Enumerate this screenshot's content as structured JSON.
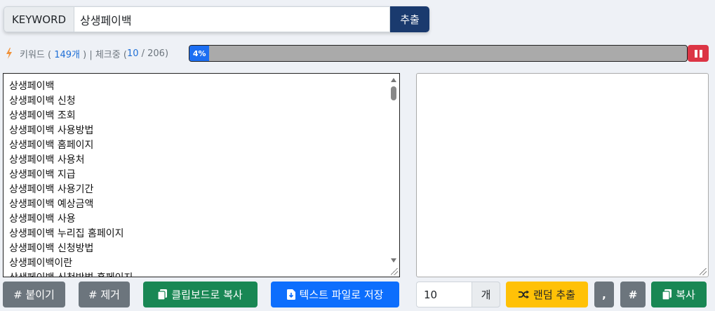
{
  "search": {
    "label": "KEYWORD",
    "value": "상생페이백",
    "button": "추출"
  },
  "status": {
    "keyword_label": "키워드 ( ",
    "keyword_count": "149개",
    "mid": " ) | 체크중 (",
    "checked": "10",
    "separator": " / ",
    "total": "206",
    "end": ")",
    "progress_label": "4%",
    "progress_fraction": 0.04
  },
  "keywords": [
    "상생페이백",
    "상생페이백 신청",
    "상생페이백 조회",
    "상생페이백 사용방법",
    "상생페이백 홈페이지",
    "상생페이백 사용처",
    "상생페이백 지급",
    "상생페이백 사용기간",
    "상생페이백 예상금액",
    "상생페이백 사용",
    "상생페이백 누리집 홈페이지",
    "상생페이백 신청방법",
    "상생페이백이란",
    "상생페이백 신청방법 홈페이지"
  ],
  "buttons": {
    "paste": "# 붙이기",
    "remove": "# 제거",
    "copy_clipboard": "클립보드로 복사",
    "save_text": "텍스트 파일로 저장",
    "count_value": "10",
    "count_suffix": "개",
    "random": "랜덤 추출",
    "comma": ",",
    "hash": "#",
    "copy": "복사"
  },
  "colors": {
    "primary_dark": "#1a3a6e",
    "progress": "#1c6ef2",
    "danger": "#dc3545",
    "success": "#198754",
    "secondary": "#6c757d",
    "warning": "#ffc107"
  }
}
